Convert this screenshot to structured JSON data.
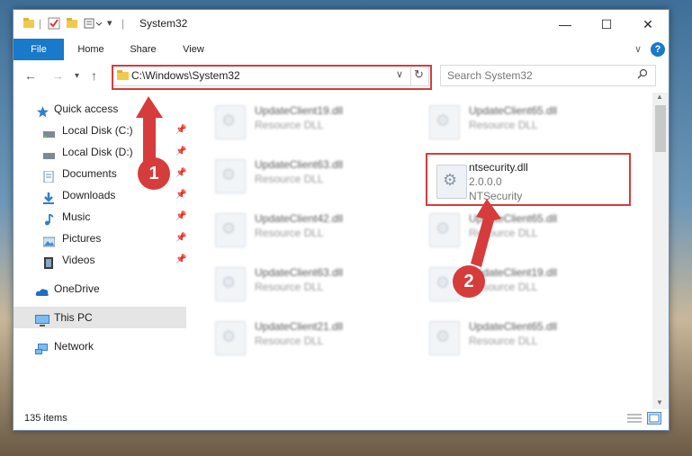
{
  "window": {
    "title": "System32",
    "minimize_glyph": "—",
    "maximize_glyph": "☐",
    "close_glyph": "✕"
  },
  "ribbon": {
    "tabs": [
      "File",
      "Home",
      "Share",
      "View"
    ],
    "chevron": "∨",
    "help": "?"
  },
  "nav": {
    "address": "C:\\Windows\\System32",
    "search_placeholder": "Search System32"
  },
  "sidebar": {
    "items": [
      {
        "label": "Quick access",
        "icon": "star-icon"
      },
      {
        "label": "Local Disk (C:)",
        "icon": "drive-icon",
        "pinned": true
      },
      {
        "label": "Local Disk (D:)",
        "icon": "drive-icon",
        "pinned": true
      },
      {
        "label": "Documents",
        "icon": "documents-icon",
        "pinned": true
      },
      {
        "label": "Downloads",
        "icon": "downloads-icon",
        "pinned": true
      },
      {
        "label": "Music",
        "icon": "music-icon",
        "pinned": true
      },
      {
        "label": "Pictures",
        "icon": "pictures-icon",
        "pinned": true
      },
      {
        "label": "Videos",
        "icon": "videos-icon",
        "pinned": true
      },
      {
        "label": "OneDrive",
        "icon": "cloud-icon"
      },
      {
        "label": "This PC",
        "icon": "computer-icon",
        "selected": true
      },
      {
        "label": "Network",
        "icon": "network-icon"
      }
    ]
  },
  "files": {
    "left": [
      {
        "name": "UpdateClient19.dll",
        "type": "Resource DLL"
      },
      {
        "name": "UpdateClient63.dll",
        "type": "Resource DLL"
      },
      {
        "name": "UpdateClient42.dll",
        "type": "Resource DLL"
      },
      {
        "name": "UpdateClient63.dll",
        "type": "Resource DLL"
      },
      {
        "name": "UpdateClient21.dll",
        "type": "Resource DLL"
      }
    ],
    "right": [
      {
        "name": "UpdateClient65.dll",
        "type": "Resource DLL"
      },
      {
        "name": "ntsecurity.dll",
        "version": "2.0.0.0",
        "type": "NTSecurity",
        "highlighted": true
      },
      {
        "name": "UpdateClient65.dll",
        "type": "Resource DLL"
      },
      {
        "name": "UpdateClient19.dll",
        "type": "Resource DLL"
      },
      {
        "name": "UpdateClient65.dll",
        "type": "Resource DLL"
      }
    ]
  },
  "status": {
    "count": "135 items"
  },
  "annotations": {
    "step1": "1",
    "step2": "2",
    "color": "#d63c3c"
  }
}
